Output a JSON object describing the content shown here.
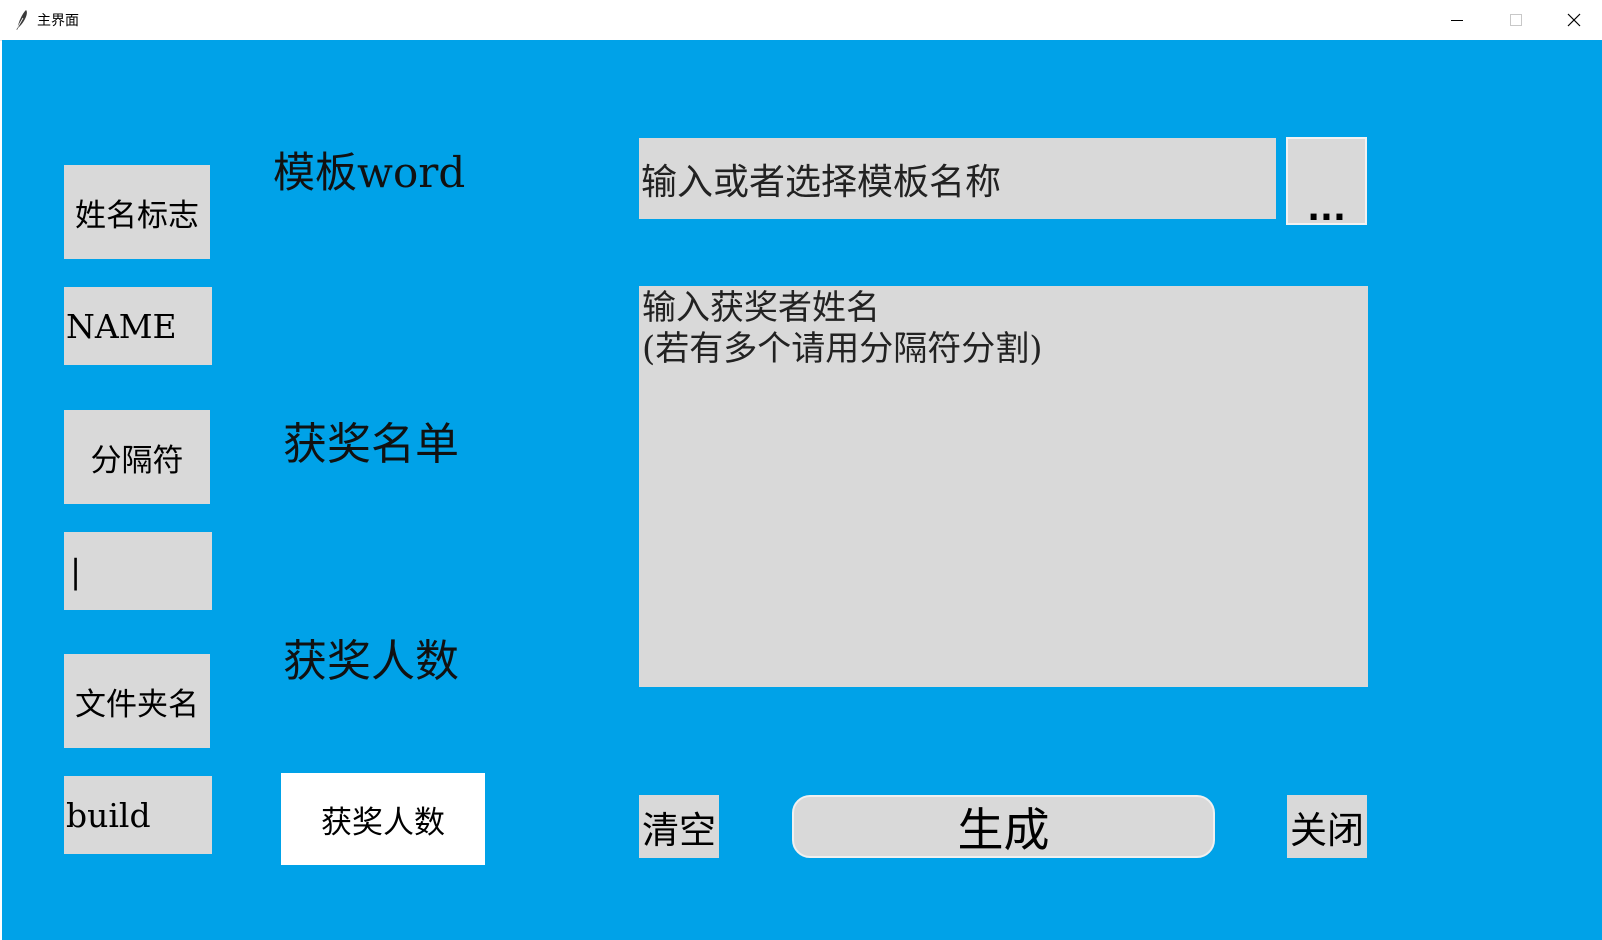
{
  "window": {
    "title": "主界面",
    "app_icon": "feather-icon",
    "controls": {
      "minimize_icon": "minimize-icon",
      "maximize_icon": "maximize-icon",
      "close_icon": "close-icon"
    }
  },
  "colors": {
    "background": "#00a2e8",
    "widget": "#d9d9d9",
    "white_button": "#ffffff"
  },
  "left_column": {
    "name_flag_button": "姓名标志",
    "name_flag_value": "NAME",
    "separator_button": "分隔符",
    "separator_value": "|",
    "folder_button": "文件夹名",
    "folder_value": "build"
  },
  "middle_column": {
    "template_label": "模板word",
    "winners_label": "获奖名单",
    "count_label": "获奖人数",
    "count_button": "获奖人数"
  },
  "right_column": {
    "template_input_value": "输入或者选择模板名称",
    "browse_button": "...",
    "names_text": "输入获奖者姓名\n(若有多个请用分隔符分割)",
    "clear_button": "清空",
    "generate_button": "生成",
    "close_button": "关闭"
  }
}
